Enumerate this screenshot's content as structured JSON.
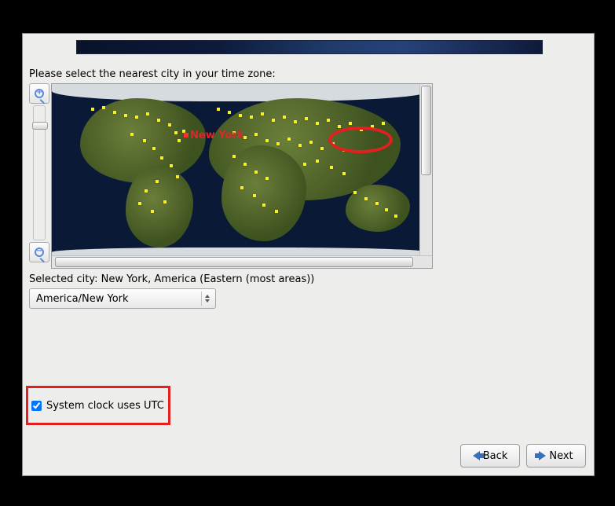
{
  "prompt": "Please select the nearest city in your time zone:",
  "selected_city": {
    "label_prefix": "Selected city: ",
    "value": "New York, America (Eastern (most areas))",
    "marker_label": "New York"
  },
  "timezone_combo": {
    "value": "America/New York"
  },
  "utc_checkbox": {
    "label": "System clock uses UTC",
    "checked": true
  },
  "buttons": {
    "back": "Back",
    "next": "Next"
  }
}
